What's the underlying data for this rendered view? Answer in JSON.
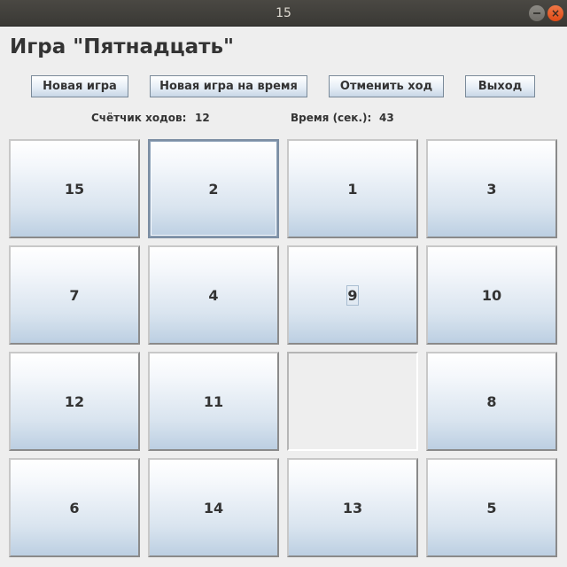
{
  "window": {
    "title": "15"
  },
  "heading": "Игра \"Пятнадцать\"",
  "toolbar": {
    "new_game": "Новая игра",
    "new_timed_game": "Новая игра на время",
    "undo": "Отменить ход",
    "exit": "Выход"
  },
  "status": {
    "moves_label": "Счётчик ходов:",
    "moves_value": "12",
    "time_label": "Время (сек.):",
    "time_value": "43"
  },
  "board": {
    "rows": [
      [
        "15",
        "2",
        "1",
        "3"
      ],
      [
        "7",
        "4",
        "9",
        "10"
      ],
      [
        "12",
        "11",
        "",
        "8"
      ],
      [
        "6",
        "14",
        "13",
        "5"
      ]
    ],
    "empty_cell": {
      "row": 3,
      "col": 3
    },
    "focused_cell": {
      "row": 1,
      "col": 2
    },
    "text_focused_cell": {
      "row": 2,
      "col": 3
    }
  },
  "colors": {
    "window_bg": "#eeeeee",
    "titlebar_bg": "#3c3b37",
    "close_button": "#e95420",
    "tile_gradient_top": "#ffffff",
    "tile_gradient_bottom": "#bccfe2",
    "text": "#333333"
  }
}
